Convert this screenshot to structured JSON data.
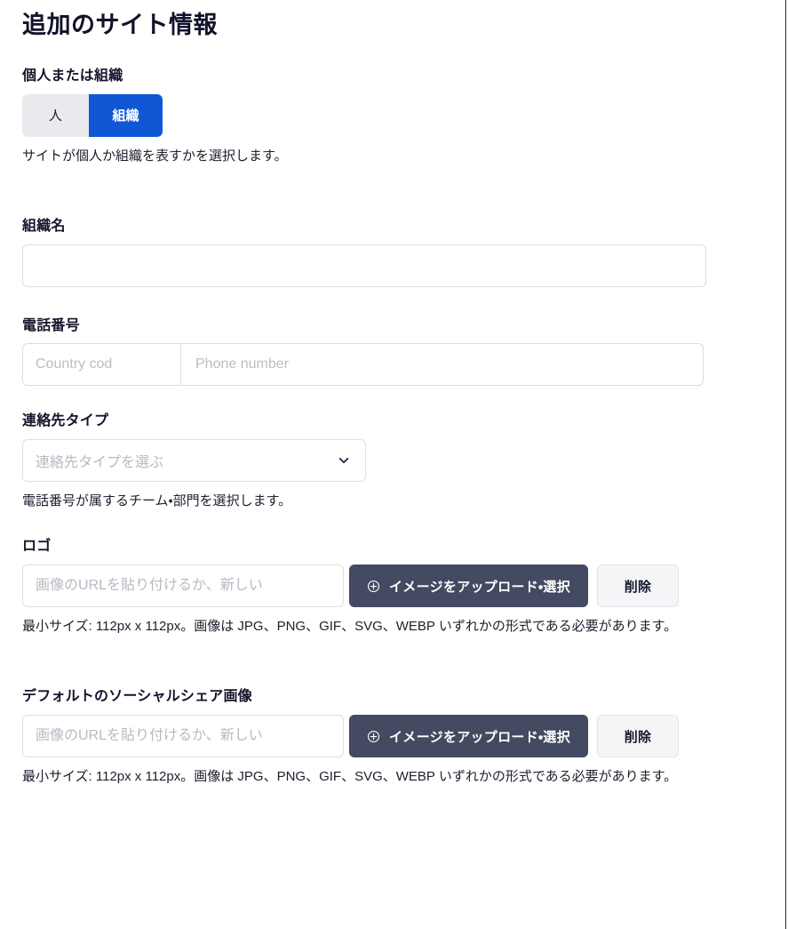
{
  "page": {
    "title": "追加のサイト情報"
  },
  "entity_type": {
    "label": "個人または組織",
    "options": [
      {
        "label": "人",
        "selected": false
      },
      {
        "label": "組織",
        "selected": true
      }
    ],
    "help": "サイトが個人か組織を表すかを選択します。",
    "active_color": "#1057d6",
    "inactive_color": "#e8eaed"
  },
  "org_name": {
    "label": "組織名",
    "value": "",
    "placeholder": ""
  },
  "phone": {
    "label": "電話番号",
    "country_placeholder": "Country cod",
    "country_value": "",
    "number_placeholder": "Phone number",
    "number_value": ""
  },
  "contact_type": {
    "label": "連絡先タイプ",
    "placeholder": "連絡先タイプを選ぶ",
    "selected": "連絡先タイプを選ぶ",
    "options": [
      "連絡先タイプを選ぶ"
    ],
    "chevron_icon": "chevron-down-icon",
    "help": "電話番号が属するチーム・部門を選択します。"
  },
  "logo": {
    "label": "ロゴ",
    "url_placeholder": "画像のURLを貼り付けるか、新しい",
    "url_value": "",
    "upload_label": "イメージをアップロード・選択",
    "upload_icon": "plus-circle-icon",
    "delete_label": "削除",
    "help": "最小サイズ: 112px x 112px。画像は JPG、PNG、GIF、SVG、WEBP いずれかの形式である必要があります。",
    "button_color": "#434a61"
  },
  "social_share": {
    "label": "デフォルトのソーシャルシェア画像",
    "url_placeholder": "画像のURLを貼り付けるか、新しい",
    "url_value": "",
    "upload_label": "イメージをアップロード・選択",
    "upload_icon": "plus-circle-icon",
    "delete_label": "削除",
    "help": "最小サイズ: 112px x 112px。画像は JPG、PNG、GIF、SVG、WEBP いずれかの形式である必要があります。",
    "button_color": "#434a61"
  }
}
